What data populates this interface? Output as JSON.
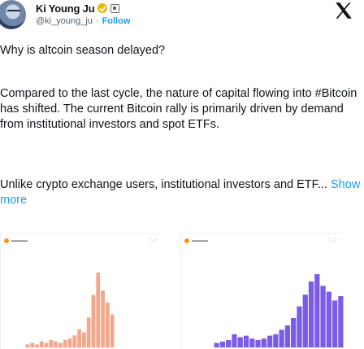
{
  "author": {
    "name": "Ki Young Ju",
    "handle": "@ki_young_ju",
    "separator": "·",
    "follow_label": "Follow"
  },
  "tweet": {
    "question": "Why is altcoin season delayed?",
    "paragraph1": "Compared to the last cycle, the nature of capital flowing into #Bitcoin has shifted. The current Bitcoin rally is primarily driven by demand from institutional investors and spot ETFs.",
    "paragraph2_text": "Unlike crypto exchange users, institutional investors and ETF...",
    "show_more": "Show more"
  },
  "colors": {
    "accent": "#1d9bf0",
    "left_bars": "#f4a78a",
    "right_bars": "#7b5ce6",
    "verified": "#f4b400"
  },
  "chart_data": [
    {
      "type": "bar",
      "series": [
        {
          "values": [
            2,
            3,
            2,
            4,
            3,
            5,
            4,
            3,
            5,
            6,
            8,
            12,
            10,
            20,
            35,
            50,
            38,
            30,
            22
          ]
        }
      ],
      "color": "#f4a78a"
    },
    {
      "type": "bar",
      "series": [
        {
          "values": [
            3,
            4,
            5,
            9,
            7,
            8,
            6,
            5,
            6,
            8,
            9,
            12,
            15,
            20,
            28,
            36,
            45,
            50,
            42,
            38,
            32,
            35
          ]
        }
      ],
      "color": "#7b5ce6"
    }
  ]
}
